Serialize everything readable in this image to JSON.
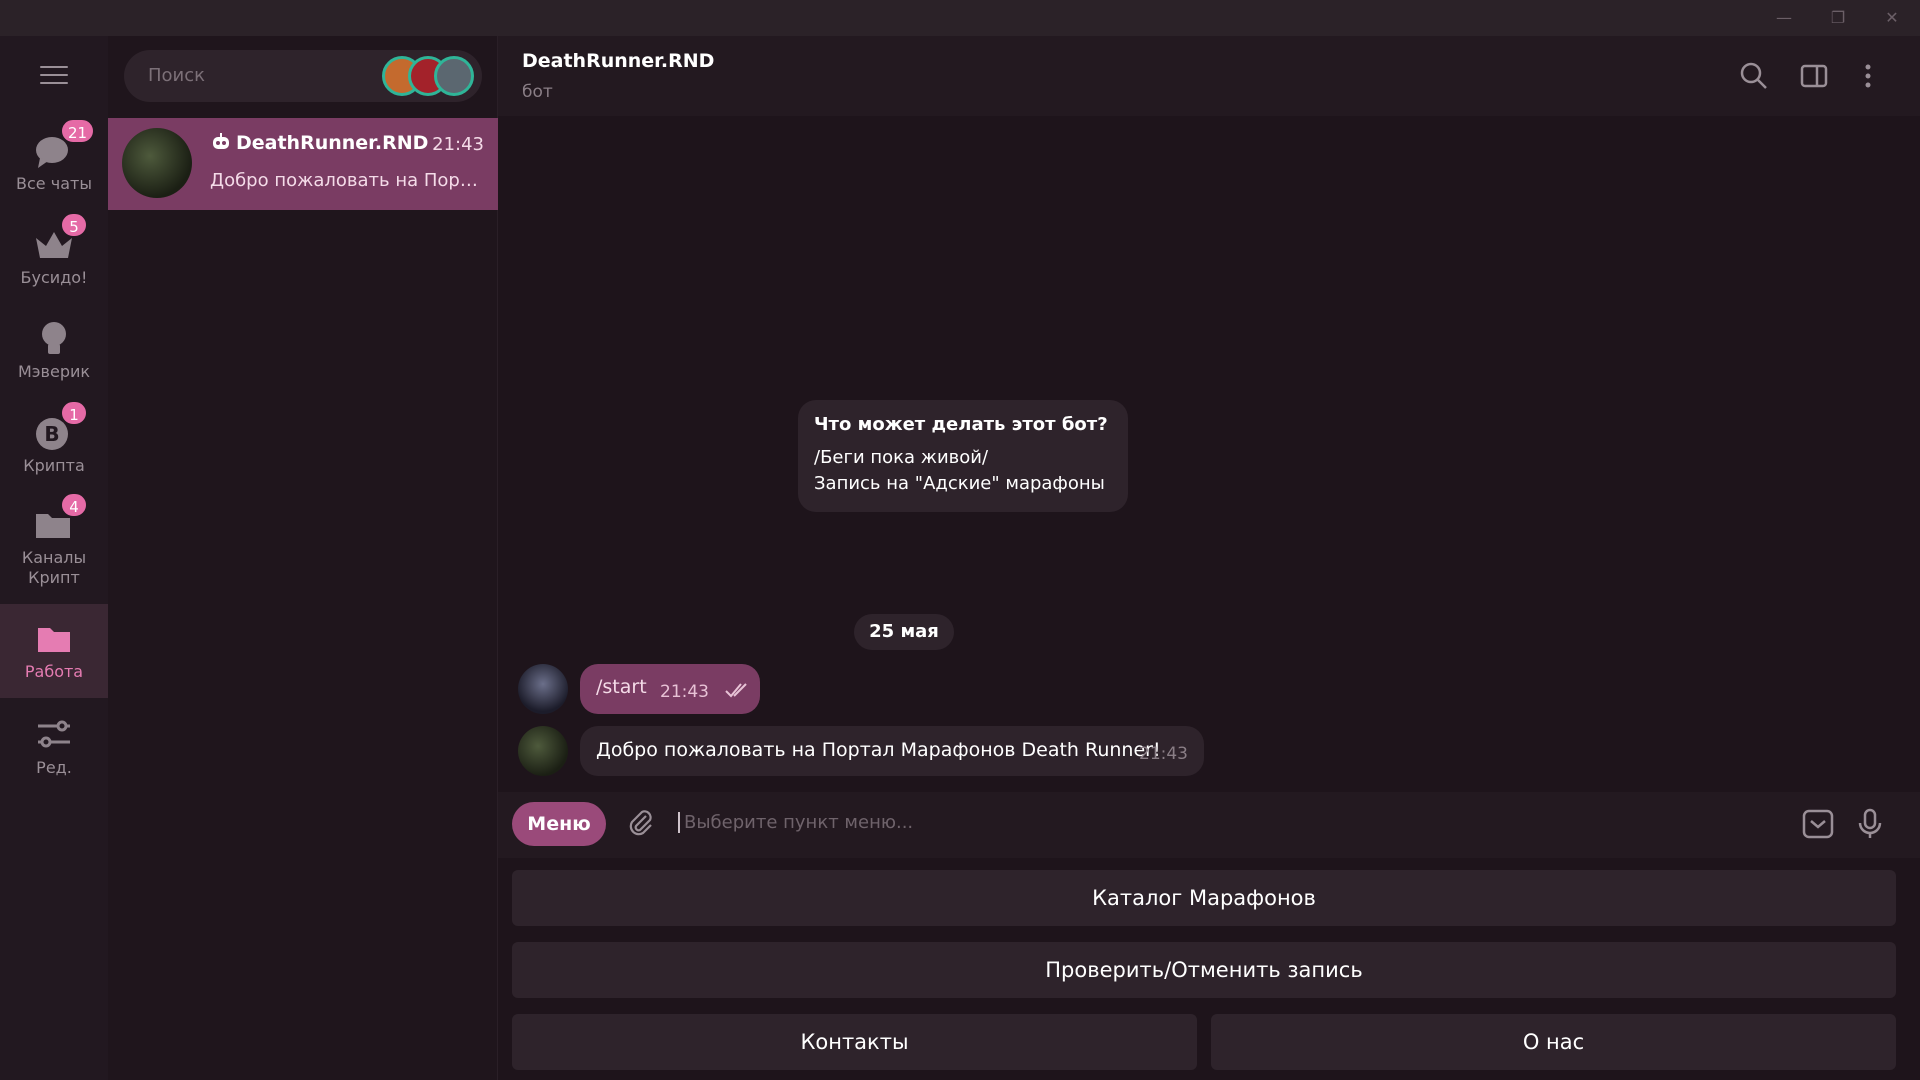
{
  "folders": [
    {
      "label": "Все чаты",
      "badge": "21",
      "icon": "chat-bubbles-icon"
    },
    {
      "label": "Бусидо!",
      "badge": "5",
      "icon": "crown-icon"
    },
    {
      "label": "Мэверик",
      "badge": "",
      "icon": "lightbulb-icon"
    },
    {
      "label": "Крипта",
      "badge": "1",
      "icon": "bitcoin-icon"
    },
    {
      "label": "Каналы Крипт",
      "badge": "4",
      "icon": "folder-icon"
    },
    {
      "label": "Работа",
      "badge": "",
      "icon": "folder-icon",
      "active": true
    },
    {
      "label": "Ред.",
      "badge": "",
      "icon": "sliders-icon"
    }
  ],
  "search": {
    "placeholder": "Поиск"
  },
  "chat_list": [
    {
      "name": "DeathRunner.RND",
      "time": "21:43",
      "preview": "Добро пожаловать на Портал Марафонов Death Runner!",
      "icon": "bot-icon"
    }
  ],
  "header": {
    "title": "DeathRunner.RND",
    "subtitle": "бот"
  },
  "intro": {
    "title": "Что может делать этот бот?",
    "line1": "/Беги пока живой/",
    "line2": "Запись на \"Адские\" марафоны"
  },
  "date_separator": "25 мая",
  "messages": [
    {
      "direction": "out",
      "text": "/start",
      "time": "21:43",
      "status": "read"
    },
    {
      "direction": "in",
      "text": "Добро пожаловать на Портал Марафонов Death Runner!",
      "time": "21:43"
    }
  ],
  "input": {
    "menu_label": "Меню",
    "placeholder": "Выберите пункт меню..."
  },
  "keyboard": {
    "catalog": "Каталог Марафонов",
    "check": "Проверить/Отменить запись",
    "contacts": "Контакты",
    "about": "О нас"
  },
  "colors": {
    "accent": "#e56aa6",
    "bubble_out": "#7a3c63",
    "menu_button": "#9a4a7a"
  }
}
